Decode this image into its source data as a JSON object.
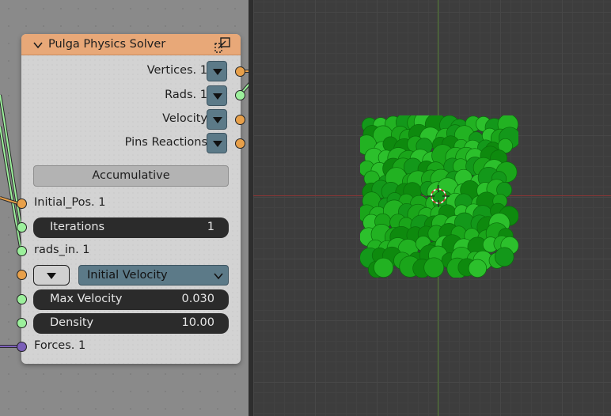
{
  "node": {
    "title": "Pulga Physics Solver",
    "header_color": "#e8a878",
    "outputs": [
      {
        "label": "Vertices. 1",
        "socket": "orange"
      },
      {
        "label": "Rads. 1",
        "socket": "green"
      },
      {
        "label": "Velocity",
        "socket": "orange"
      },
      {
        "label": "Pins Reactions",
        "socket": "orange"
      }
    ],
    "accumulative_label": "Accumulative",
    "inputs": {
      "initial_pos": "Initial_Pos. 1",
      "iterations": {
        "label": "Iterations",
        "value": "1"
      },
      "rads_in": "rads_in. 1",
      "initial_velocity_select": "Initial Velocity",
      "max_velocity": {
        "label": "Max Velocity",
        "value": "0.030"
      },
      "density": {
        "label": "Density",
        "value": "10.00"
      },
      "forces": "Forces. 1"
    }
  },
  "colors": {
    "socket_orange": "#e8a04a",
    "socket_green": "#9cf09c",
    "socket_purple": "#7b5fb8",
    "blob_green": "#1aa51a",
    "axis_x": "#8a3535"
  },
  "icons": [
    "chevron-down-icon",
    "solver-node-icon",
    "dropdown-arrow-icon",
    "3d-cursor-icon"
  ]
}
